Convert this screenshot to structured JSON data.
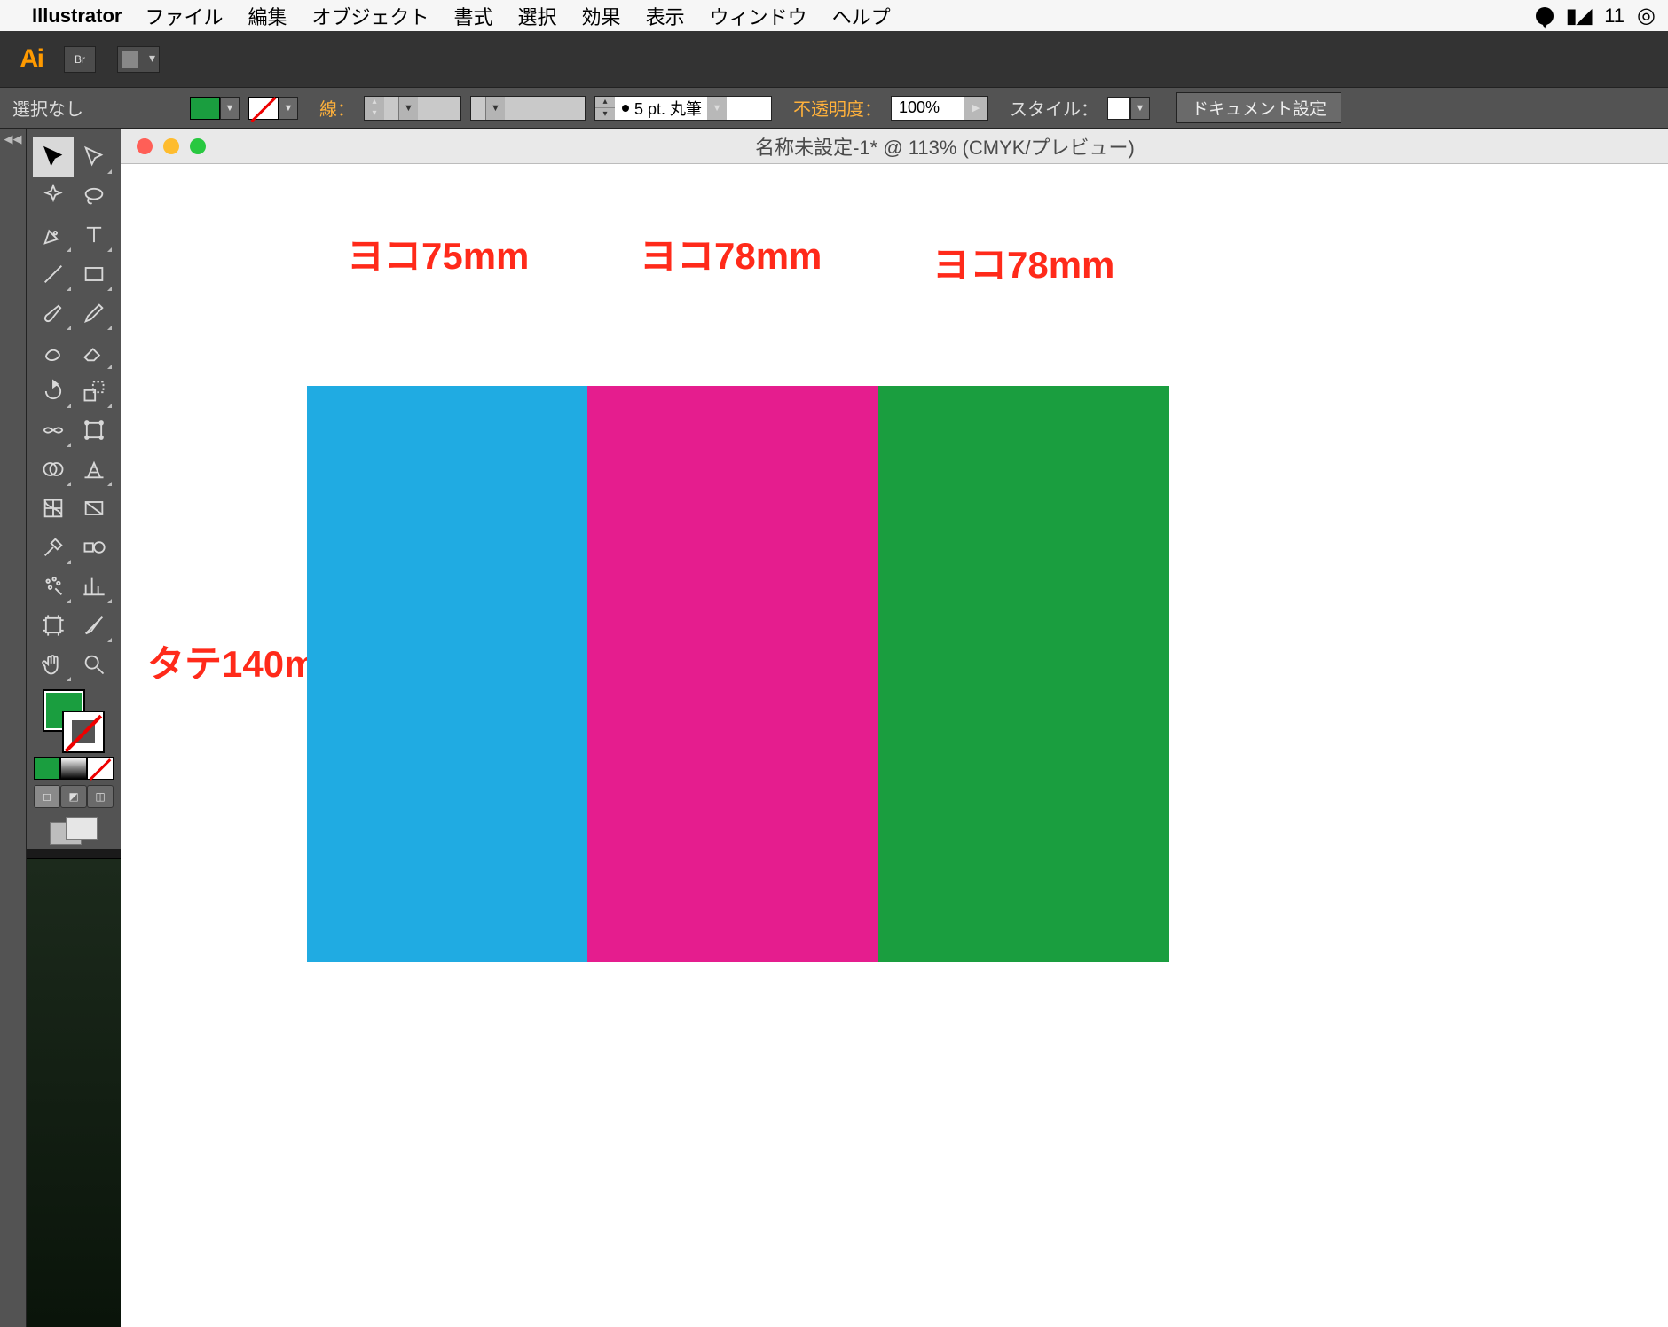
{
  "mac_menu": {
    "app_name": "Illustrator",
    "items": [
      "ファイル",
      "編集",
      "オブジェクト",
      "書式",
      "選択",
      "効果",
      "表示",
      "ウィンドウ",
      "ヘルプ"
    ],
    "right": {
      "adobe_symbol": "▮◢",
      "adobe_count": "11"
    }
  },
  "app_top": {
    "logo": "Ai",
    "bridge_label": "Br"
  },
  "control_bar": {
    "selection_none": "選択なし",
    "stroke_label": "線：",
    "stroke_value": "5 pt. 丸筆",
    "opacity_label": "不透明度：",
    "opacity_value": "100%",
    "style_label": "スタイル：",
    "doc_settings": "ドキュメント設定"
  },
  "document": {
    "title": "名称未設定-1* @ 113% (CMYK/プレビュー)"
  },
  "annotations": {
    "label1": "ヨコ75mm",
    "label2": "ヨコ78mm",
    "label3": "ヨコ78mm",
    "label_v": "タテ140mm"
  },
  "colors": {
    "rect1": "#20abe2",
    "rect2": "#e51d8e",
    "rect3": "#1a9e3f",
    "annotation": "#ff2a1a"
  },
  "dimensions": {
    "height_mm": 140,
    "widths_mm": [
      75,
      78,
      78
    ]
  },
  "left_strip_collapse": "◀◀"
}
